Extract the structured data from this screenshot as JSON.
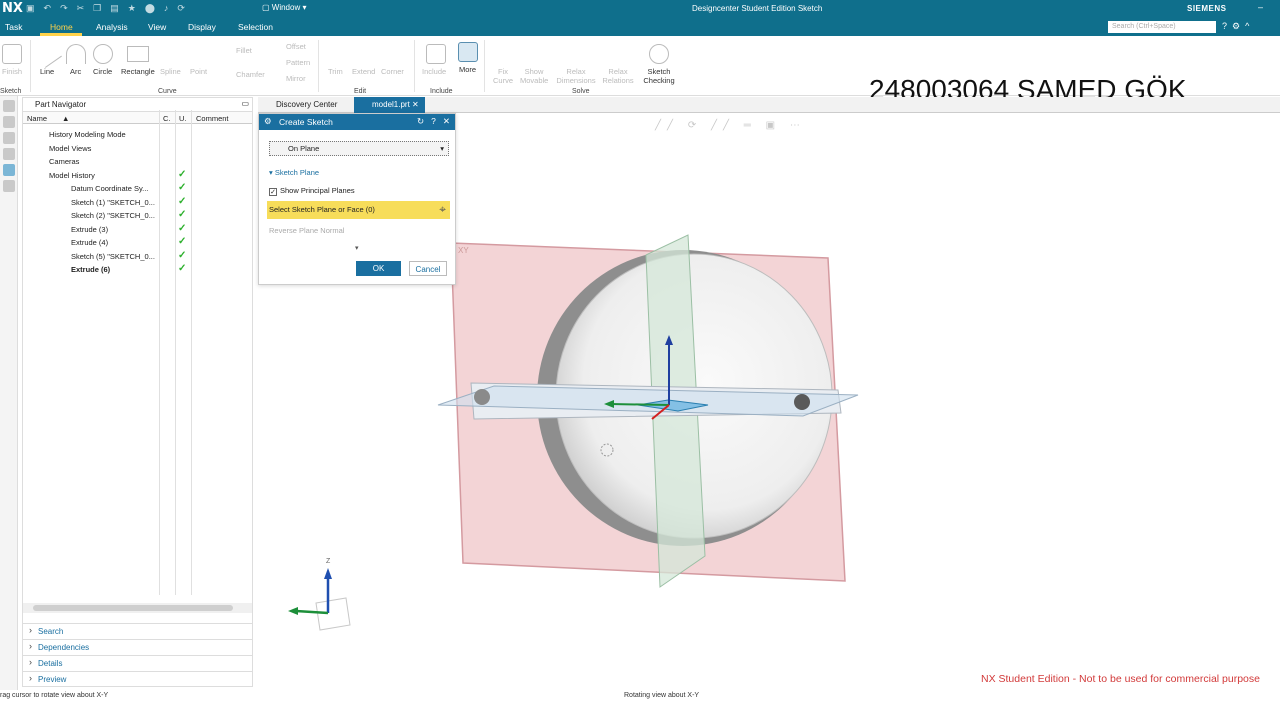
{
  "app": {
    "logo": "NX",
    "title": "Designcenter Student Edition Sketch",
    "brand": "SIEMENS",
    "window_menu": "Window"
  },
  "menu": {
    "tabs": [
      "Task",
      "Home",
      "Analysis",
      "View",
      "Display",
      "Selection"
    ],
    "active_tab": "Home",
    "search_placeholder": "Search (Ctrl+Space)"
  },
  "ribbon": {
    "finish_label": "Finish",
    "curve_tools": [
      "Line",
      "Arc",
      "Circle",
      "Rectangle",
      "Spline",
      "Point"
    ],
    "chamfer_label": "Chamfer",
    "fillet_label": "Fillet",
    "offset_label": "Offset",
    "pattern_label": "Pattern",
    "mirror_label": "Mirror",
    "edit_tools": [
      "Trim",
      "Extend",
      "Corner"
    ],
    "include_tools": [
      "Include",
      "More"
    ],
    "solve_tools": [
      "Fix Curve",
      "Show Movable",
      "Relax Dimensions",
      "Relax Relations"
    ],
    "sketch_checking": "Sketch Checking",
    "groups": {
      "sketch": "Sketch",
      "curve": "Curve",
      "edit": "Edit",
      "include": "Include",
      "solve": "Solve"
    }
  },
  "navigator": {
    "title": "Part Navigator",
    "columns": {
      "name": "Name",
      "c": "C.",
      "u": "U.",
      "comment": "Comment"
    },
    "items": [
      {
        "label": "History Modeling Mode",
        "indent": 1,
        "check": false
      },
      {
        "label": "Model Views",
        "indent": 1,
        "check": false
      },
      {
        "label": "Cameras",
        "indent": 1,
        "check": false
      },
      {
        "label": "Model History",
        "indent": 1,
        "check": true
      },
      {
        "label": "Datum Coordinate Sy...",
        "indent": 2,
        "check": true
      },
      {
        "label": "Sketch (1) \"SKETCH_0...",
        "indent": 2,
        "check": true
      },
      {
        "label": "Sketch (2) \"SKETCH_0...",
        "indent": 2,
        "check": true
      },
      {
        "label": "Extrude (3)",
        "indent": 2,
        "check": true
      },
      {
        "label": "Extrude (4)",
        "indent": 2,
        "check": true
      },
      {
        "label": "Sketch (5) \"SKETCH_0...",
        "indent": 2,
        "check": true
      },
      {
        "label": "Extrude (6)",
        "indent": 2,
        "check": true,
        "bold": true
      }
    ],
    "panels": [
      "Search",
      "Dependencies",
      "Details",
      "Preview"
    ]
  },
  "graphics_tabs": {
    "discovery": "Discovery Center",
    "model": "model1.prt"
  },
  "dialog": {
    "title": "Create Sketch",
    "type_value": "On Plane",
    "section": "Sketch Plane",
    "show_principal_planes": "Show Principal Planes",
    "select_prompt": "Select Sketch Plane or Face (0)",
    "reverse_normal": "Reverse Plane Normal",
    "ok": "OK",
    "cancel": "Cancel"
  },
  "overlay_text": "248003064 SAMED GÖK",
  "watermark": "NX Student Edition - Not to be used for commercial purpose",
  "status": {
    "left": "rag cursor to rotate view about X-Y",
    "center": "Rotating view about X-Y"
  },
  "plane_label": "XY",
  "triad": {
    "z_label": "Z"
  }
}
